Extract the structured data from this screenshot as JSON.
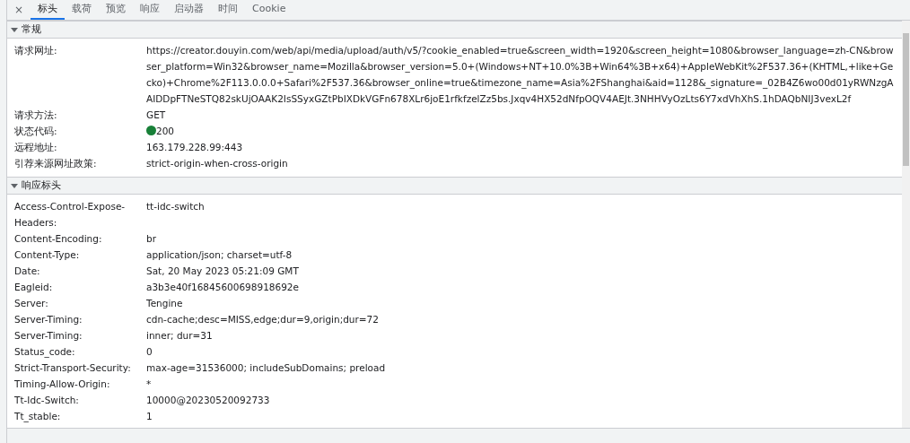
{
  "close_label": "×",
  "tabs": [
    {
      "label": "标头",
      "selected": true
    },
    {
      "label": "载荷",
      "selected": false
    },
    {
      "label": "预览",
      "selected": false
    },
    {
      "label": "响应",
      "selected": false
    },
    {
      "label": "启动器",
      "selected": false
    },
    {
      "label": "时间",
      "selected": false
    },
    {
      "label": "Cookie",
      "selected": false
    }
  ],
  "sections": [
    {
      "title": "常规",
      "expanded": true,
      "rows": [
        {
          "name": "请求网址:",
          "value": "https://creator.douyin.com/web/api/media/upload/auth/v5/?cookie_enabled=true&screen_width=1920&screen_height=1080&browser_language=zh-CN&browser_platform=Win32&browser_name=Mozilla&browser_version=5.0+(Windows+NT+10.0%3B+Win64%3B+x64)+AppleWebKit%2F537.36+(KHTML,+like+Gecko)+Chrome%2F113.0.0.0+Safari%2F537.36&browser_online=true&timezone_name=Asia%2FShanghai&aid=1128&_signature=_02B4Z6wo00d01yRWNzgAAIDDpFTNeSTQ82skUjOAAK2IsSSyxGZtPbIXDkVGFn678XLr6joE1rfkfzelZz5bs.Jxqv4HX52dNfpOQV4AEJt.3NHHVyOzLts6Y7xdVhXhS.1hDAQbNIJ3vexL2f"
        },
        {
          "name": "请求方法:",
          "value": "GET"
        },
        {
          "name": "状态代码:",
          "value": "200",
          "color": "#188038"
        },
        {
          "name": "远程地址:",
          "value": "163.179.228.99:443"
        },
        {
          "name": "引荐来源网址政策:",
          "value": "strict-origin-when-cross-origin"
        }
      ]
    },
    {
      "title": "响应标头",
      "expanded": true,
      "rows": [
        {
          "name": "Access-Control-Expose-Headers:",
          "value": "tt-idc-switch"
        },
        {
          "name": "Content-Encoding:",
          "value": "br"
        },
        {
          "name": "Content-Type:",
          "value": "application/json; charset=utf-8"
        },
        {
          "name": "Date:",
          "value": "Sat, 20 May 2023 05:21:09 GMT"
        },
        {
          "name": "Eagleid:",
          "value": "a3b3e40f16845600698918692e"
        },
        {
          "name": "Server:",
          "value": "Tengine"
        },
        {
          "name": "Server-Timing:",
          "value": "cdn-cache;desc=MISS,edge;dur=9,origin;dur=72"
        },
        {
          "name": "Server-Timing:",
          "value": "inner; dur=31"
        },
        {
          "name": "Status_code:",
          "value": "0"
        },
        {
          "name": "Strict-Transport-Security:",
          "value": "max-age=31536000; includeSubDomains; preload"
        },
        {
          "name": "Timing-Allow-Origin:",
          "value": "*"
        },
        {
          "name": "Tt-Idc-Switch:",
          "value": "10000@20230520092733"
        },
        {
          "name": "Tt_stable:",
          "value": "1"
        }
      ]
    }
  ]
}
